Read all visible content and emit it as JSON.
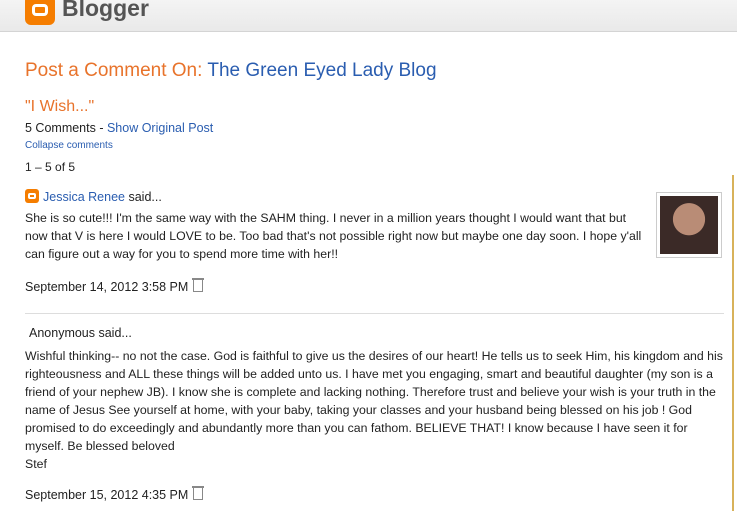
{
  "header": {
    "logo_text": "Blogger"
  },
  "page": {
    "heading_prefix": "Post a Comment On: ",
    "blog_name": "The Green Eyed Lady Blog",
    "post_title": "\"I Wish...\"",
    "comment_count": "5 Comments",
    "separator": " - ",
    "show_original": "Show Original Post",
    "collapse": "Collapse comments",
    "range": "1 – 5 of 5"
  },
  "comments": [
    {
      "author": "Jessica Renee",
      "said": " said...",
      "body": "She is so cute!!! I'm the same way with the SAHM thing. I never in a million years thought I would want that but now that V is here I would LOVE to be. Too bad that's not possible right now but maybe one day soon. I hope y'all can figure out a way for you to spend more time with her!!",
      "date": "September 14, 2012 3:58 PM"
    },
    {
      "author": "Anonymous said...",
      "body": "Wishful thinking-- no not the case. God is faithful to give us the desires of our heart! He tells us to seek Him, his kingdom and his righteousness and ALL these things will be added unto us. I have met you engaging, smart and beautiful daughter (my son is a friend of your nephew JB). I know she is complete and lacking nothing. Therefore trust and believe your wish is your truth in the name of Jesus See yourself at home, with your baby, taking your classes and your husband being blessed on his job ! God promised to do exceedingly and abundantly more than you can fathom. BELIEVE THAT! I know because I have seen it for myself. Be blessed beloved",
      "signature": "Stef",
      "date": "September 15, 2012 4:35 PM"
    }
  ],
  "icons": {
    "logo": "blogger-icon",
    "delete": "trash-icon",
    "profile": "blogger-profile-icon"
  }
}
